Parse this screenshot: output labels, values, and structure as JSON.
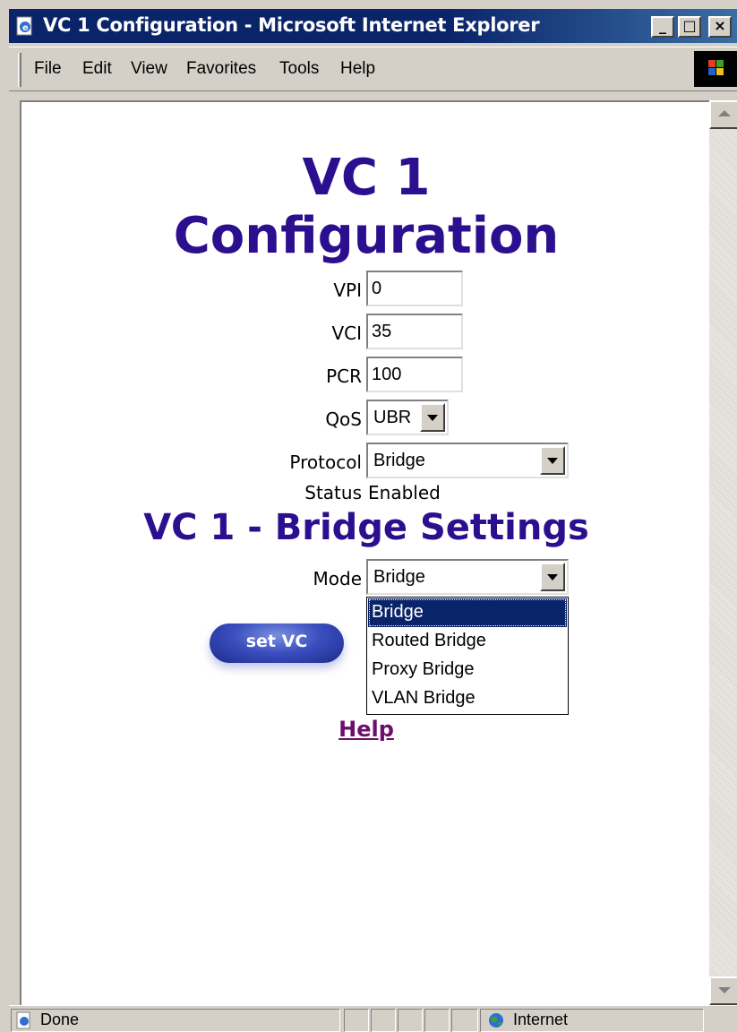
{
  "window": {
    "title": "VC 1 Configuration - Microsoft Internet Explorer",
    "controls": {
      "minimize": "_",
      "maximize": "□",
      "close": "×"
    }
  },
  "menu": {
    "items": [
      "File",
      "Edit",
      "View",
      "Favorites",
      "Tools",
      "Help"
    ]
  },
  "page": {
    "heading_line1": "VC 1",
    "heading_line2": "Configuration",
    "fields": {
      "vpi_label": "VPI",
      "vpi_value": "0",
      "vci_label": "VCI",
      "vci_value": "35",
      "pcr_label": "PCR",
      "pcr_value": "100",
      "qos_label": "QoS",
      "qos_value": "UBR",
      "protocol_label": "Protocol",
      "protocol_value": "Bridge",
      "status_label": "Status",
      "status_value": "Enabled"
    },
    "bridge_heading": "VC 1 - Bridge Settings",
    "mode_label": "Mode",
    "mode_value": "Bridge",
    "mode_options": [
      "Bridge",
      "Routed Bridge",
      "Proxy Bridge",
      "VLAN Bridge"
    ],
    "mode_selected": "Bridge",
    "set_button": "set VC",
    "help_link": "Help"
  },
  "statusbar": {
    "status": "Done",
    "zone": "Internet"
  },
  "colors": {
    "heading": "#2b0f8f",
    "titlebar": "#0a246a",
    "link_visited": "#6b0f6b",
    "selection": "#0a246a"
  },
  "icons": [
    "ie-page-icon",
    "windows-logo-icon",
    "globe-icon",
    "scroll-up-arrow-icon",
    "scroll-down-arrow-icon",
    "dropdown-arrow-icon"
  ]
}
